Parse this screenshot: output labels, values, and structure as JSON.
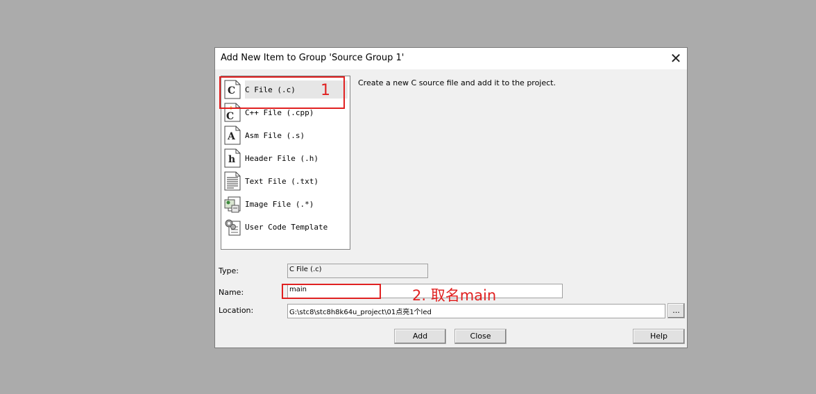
{
  "dialog": {
    "title": "Add New Item to Group 'Source Group 1'",
    "close_glyph": "✕",
    "description": "Create a new C source file and add it to the project.",
    "items": [
      {
        "label": "C File (.c)",
        "icon": "c-file-icon",
        "glyph": "C"
      },
      {
        "label": "C++ File (.cpp)",
        "icon": "cpp-file-icon",
        "glyph": "C"
      },
      {
        "label": "Asm File (.s)",
        "icon": "asm-file-icon",
        "glyph": "A"
      },
      {
        "label": "Header File (.h)",
        "icon": "header-file-icon",
        "glyph": "h"
      },
      {
        "label": "Text File (.txt)",
        "icon": "text-file-icon",
        "glyph": ""
      },
      {
        "label": "Image File (.*)",
        "icon": "image-file-icon",
        "glyph": ""
      },
      {
        "label": "User Code Template",
        "icon": "gear-template-icon",
        "glyph": ""
      }
    ],
    "selected_index": 0,
    "type_label": "Type:",
    "type_value": "C File (.c)",
    "name_label": "Name:",
    "name_value": "main",
    "location_label": "Location:",
    "location_value": "G:\\stc8\\stc8h8k64u_project\\01点亮1个led",
    "browse_label": "...",
    "add_label": "Add",
    "close_label": "Close",
    "help_label": "Help"
  },
  "annotations": {
    "step1": "1",
    "step2": "2.  取名main",
    "color": "#e02020"
  }
}
